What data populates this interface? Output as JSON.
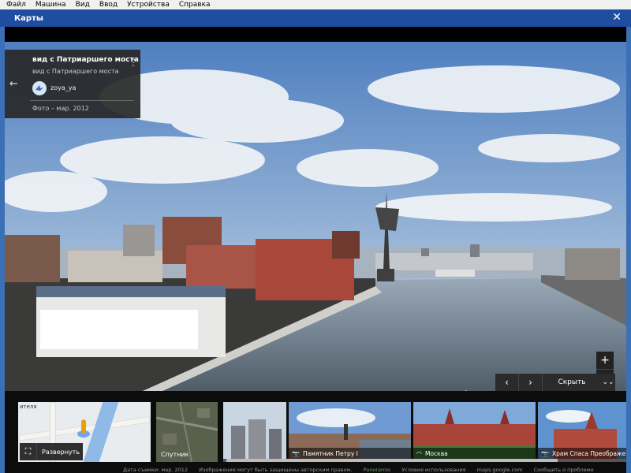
{
  "vm_menu": [
    "Файл",
    "Машина",
    "Вид",
    "Ввод",
    "Устройства",
    "Справка"
  ],
  "window": {
    "title": "Карты",
    "close_glyph": "✕"
  },
  "info_card": {
    "title": "вид с Патриаршего моста",
    "subtitle": "вид с Патриаршего моста",
    "user": "zoya_ya",
    "date": "Фото – мар. 2012",
    "back_glyph": "←",
    "menu_glyph": "⋮"
  },
  "zoom": {
    "in": "+",
    "out": "−"
  },
  "strip_nav": {
    "prev": "‹",
    "next": "›",
    "hide_label": "Скрыть",
    "collapse_glyph": "⌄⌄"
  },
  "map_thumb": {
    "text": "ителя",
    "expand_label": "Развернуть",
    "expand_glyph": "⛶"
  },
  "satellite": {
    "label": "Спутник"
  },
  "photos": [
    {
      "caption": ""
    },
    {
      "caption": "Памятник Петру I",
      "icon": "camera-icon"
    },
    {
      "caption": "Москва",
      "icon": "panorama-icon"
    },
    {
      "caption": "Храм Спаса Преображе",
      "icon": "camera-icon"
    }
  ],
  "footer": {
    "capture": "Дата съемки: мар. 2012",
    "copyright": "Изображения могут быть защищены авторским правом.",
    "brand": "Panoramio",
    "terms": "Условия использования",
    "site": "maps.google.com",
    "report": "Сообщить о проблеме"
  }
}
